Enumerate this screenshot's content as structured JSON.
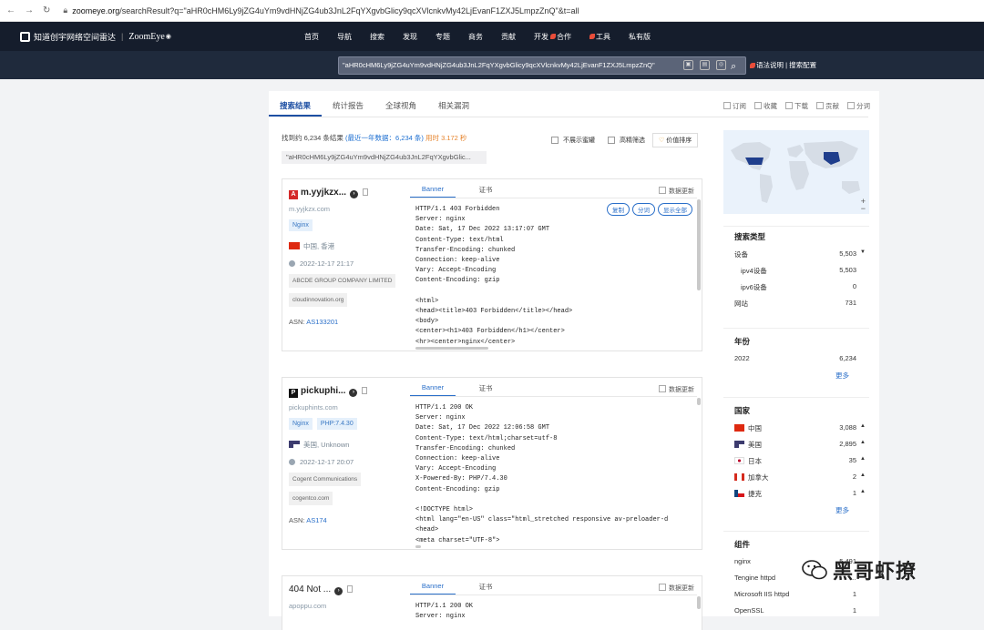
{
  "browser": {
    "back": "←",
    "forward": "→",
    "reload": "↻",
    "url_host": "zoomeye.org",
    "url_path": "/searchResult?q=\"aHR0cHM6Ly9jZG4uYm9vdHNjZG4ub3JnL2FqYXgvbGlicy9qcXVlcnkvMy42LjEvanF1ZXJ5LmpzZnQ\"&t=all"
  },
  "header": {
    "logo_cn": "知道创宇网络空间雷达",
    "logo_en": "ZoomEye",
    "menu": [
      "首页",
      "导航",
      "搜索",
      "发现",
      "专题",
      "商务",
      "贡献",
      "开发",
      "合作",
      "工具",
      "私有版"
    ]
  },
  "search": {
    "query": "\"aHR0cHM6Ly9jZG4uYm9vdHNjZG4ub3JnL2FqYXgvbGlicy9qcXVlcnkvMy42LjEvanF1ZXJ5LmpzZnQ\"",
    "syntax_link": "语法说明",
    "subscribe_link": "搜索配置"
  },
  "tabs": [
    "搜索结果",
    "统计报告",
    "全球视角",
    "相关漏洞"
  ],
  "actions": [
    "订阅",
    "收藏",
    "下载",
    "贡献",
    "分词"
  ],
  "summary": {
    "found": "找到约 6,234 条结果",
    "recent": "(最近一年数据：6,234 条)",
    "elapsed": "用时 3.172 秒"
  },
  "filters": {
    "hide_honeypot": "不展示蜜罐",
    "precise": "高精筛选",
    "sort": "价值排序"
  },
  "query_tag": "\"aHR0cHM6Ly9jZG4uYm9vdHNjZG4ub3JnL2FqYXgvbGlic...",
  "results": [
    {
      "host": "m.yyjkzx...",
      "domain": "m.yyjkzx.com",
      "tags": [
        "Nginx"
      ],
      "location": "中国, 香港",
      "time": "2022-12-17 21:17",
      "org": "ABCDE GROUP COMPANY LIMITED",
      "isp": "cloudinnovation.org",
      "asn_label": "ASN:",
      "asn": "AS133201",
      "tab_banner": "Banner",
      "tab_cert": "证书",
      "update": "数据更新",
      "buttons": [
        "复制",
        "分词",
        "显示全部"
      ],
      "banner": "HTTP/1.1 403 Forbidden\nServer: nginx\nDate: Sat, 17 Dec 2022 13:17:07 GMT\nContent-Type: text/html\nTransfer-Encoding: chunked\nConnection: keep-alive\nVary: Accept-Encoding\nContent-Encoding: gzip\n\n<html>\n<head><title>403 Forbidden</title></head>\n<body>\n<center><h1>403 Forbidden</h1></center>\n<hr><center>nginx</center>"
    },
    {
      "host": "pickuphi...",
      "domain": "pickuphints.com",
      "tags": [
        "Nginx",
        "PHP:7.4.30"
      ],
      "location": "美国, Unknown",
      "time": "2022-12-17 20:07",
      "org": "Cogent Communications",
      "isp": "cogentco.com",
      "asn_label": "ASN:",
      "asn": "AS174",
      "tab_banner": "Banner",
      "tab_cert": "证书",
      "update": "数据更新",
      "buttons": [],
      "banner": "HTTP/1.1 200 OK\nServer: nginx\nDate: Sat, 17 Dec 2022 12:06:58 GMT\nContent-Type: text/html;charset=utf-8\nTransfer-Encoding: chunked\nConnection: keep-alive\nVary: Accept-Encoding\nX-Powered-By: PHP/7.4.30\nContent-Encoding: gzip\n\n<!DOCTYPE html>\n<html lang=\"en-US\" class=\"html_stretched responsive av-preloader-d\n<head>\n<meta charset=\"UTF-8\">"
    },
    {
      "host": "404 Not ...",
      "domain": "apoppu.com",
      "tags": [],
      "location": "",
      "time": "",
      "org": "",
      "isp": "",
      "asn_label": "",
      "asn": "",
      "tab_banner": "Banner",
      "tab_cert": "证书",
      "update": "数据更新",
      "buttons": [],
      "banner": "HTTP/1.1 200 OK\nServer: nginx"
    }
  ],
  "sidebar": {
    "search_type": {
      "title": "搜索类型",
      "rows": [
        {
          "label": "设备",
          "value": "5,503",
          "arrow": "▼"
        },
        {
          "label": "ipv4设备",
          "value": "5,503"
        },
        {
          "label": "ipv6设备",
          "value": "0"
        },
        {
          "label": "网站",
          "value": "731"
        }
      ]
    },
    "year": {
      "title": "年份",
      "rows": [
        {
          "label": "2022",
          "value": "6,234"
        }
      ],
      "more": "更多"
    },
    "country": {
      "title": "国家",
      "rows": [
        {
          "label": "中国",
          "value": "3,088",
          "arrow": "▲"
        },
        {
          "label": "美国",
          "value": "2,895",
          "arrow": "▲"
        },
        {
          "label": "日本",
          "value": "35",
          "arrow": "▲"
        },
        {
          "label": "加拿大",
          "value": "2",
          "arrow": "▲"
        },
        {
          "label": "捷克",
          "value": "1",
          "arrow": "▲"
        }
      ],
      "more": "更多"
    },
    "component": {
      "title": "组件",
      "rows": [
        {
          "label": "nginx",
          "value": "5,491"
        },
        {
          "label": "Tengine httpd",
          "value": "…"
        },
        {
          "label": "Microsoft IIS httpd",
          "value": "1"
        },
        {
          "label": "OpenSSL",
          "value": "1"
        }
      ]
    }
  },
  "watermark": "黑哥虾撩",
  "colors": {
    "nav_bg": "#151d2c",
    "accent": "#1d4fa3",
    "link": "#2a6fc9",
    "orange": "#e6842e"
  }
}
